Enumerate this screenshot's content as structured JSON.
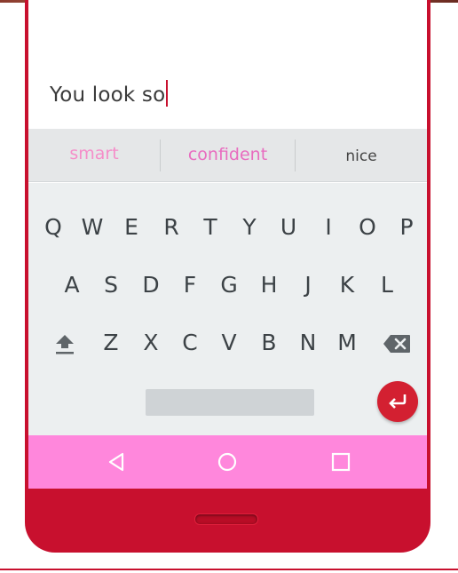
{
  "text_field": {
    "value": "You look so"
  },
  "suggestions": [
    "smart",
    "confident",
    "nice"
  ],
  "keyboard": {
    "row1": [
      "Q",
      "W",
      "E",
      "R",
      "T",
      "Y",
      "U",
      "I",
      "O",
      "P"
    ],
    "row2": [
      "A",
      "S",
      "D",
      "F",
      "G",
      "H",
      "J",
      "K",
      "L"
    ],
    "row3": [
      "Z",
      "X",
      "C",
      "V",
      "B",
      "N",
      "M"
    ]
  },
  "icons": {
    "shift": "shift-icon",
    "backspace": "backspace-icon",
    "enter": "enter-icon",
    "back": "nav-back-icon",
    "home": "nav-home-icon",
    "recents": "nav-recents-icon"
  },
  "colors": {
    "phone_body": "#c8102e",
    "nav_bar": "#ff87dc",
    "suggestion_highlight": "#e86cbf",
    "enter_key": "#d32031"
  }
}
